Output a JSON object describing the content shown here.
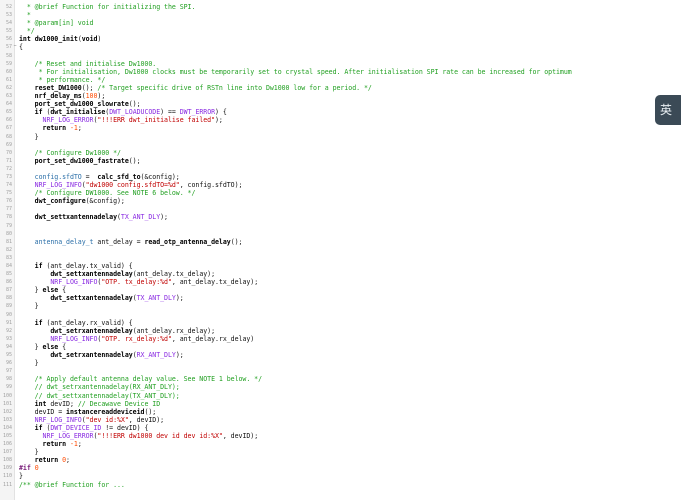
{
  "ime_indicator": "英",
  "lines": [
    {
      "n": "52",
      "fold": "",
      "parts": [
        {
          "c": "cm",
          "t": "  * @brief Function for initializing the SPI."
        }
      ]
    },
    {
      "n": "53",
      "fold": "",
      "parts": [
        {
          "c": "cm",
          "t": "  *"
        }
      ]
    },
    {
      "n": "54",
      "fold": "",
      "parts": [
        {
          "c": "cm",
          "t": "  * @param[in] void"
        }
      ]
    },
    {
      "n": "55",
      "fold": "",
      "parts": [
        {
          "c": "cm",
          "t": "  */"
        }
      ]
    },
    {
      "n": "56",
      "fold": "",
      "parts": [
        {
          "c": "kw",
          "t": "int"
        },
        {
          "c": "",
          "t": " "
        },
        {
          "c": "fn",
          "t": "dw1000_init"
        },
        {
          "c": "",
          "t": "("
        },
        {
          "c": "kw",
          "t": "void"
        },
        {
          "c": "",
          "t": ")"
        }
      ]
    },
    {
      "n": "57",
      "fold": "−",
      "parts": [
        {
          "c": "",
          "t": "{"
        }
      ]
    },
    {
      "n": "58",
      "fold": "",
      "parts": [
        {
          "c": "",
          "t": ""
        }
      ]
    },
    {
      "n": "59",
      "fold": "",
      "parts": [
        {
          "c": "cm",
          "t": "    /* Reset and initialise Dw1000."
        }
      ]
    },
    {
      "n": "60",
      "fold": "",
      "parts": [
        {
          "c": "cm",
          "t": "     * For initialisation, Dw1000 clocks must be temporarily set to crystal speed. After initialisation SPI rate can be increased for optimum"
        }
      ]
    },
    {
      "n": "61",
      "fold": "",
      "parts": [
        {
          "c": "cm",
          "t": "     * performance. */"
        }
      ]
    },
    {
      "n": "62",
      "fold": "",
      "parts": [
        {
          "c": "fn",
          "t": "    reset_DW1000"
        },
        {
          "c": "",
          "t": "(); "
        },
        {
          "c": "cm",
          "t": "/* Target specific drive of RSTn line into Dw1000 low for a period. */"
        }
      ]
    },
    {
      "n": "63",
      "fold": "",
      "parts": [
        {
          "c": "fn",
          "t": "    nrf_delay_ms"
        },
        {
          "c": "",
          "t": "("
        },
        {
          "c": "num",
          "t": "100"
        },
        {
          "c": "",
          "t": ");"
        }
      ]
    },
    {
      "n": "64",
      "fold": "",
      "parts": [
        {
          "c": "fn",
          "t": "    port_set_dw1000_slowrate"
        },
        {
          "c": "",
          "t": "();"
        }
      ]
    },
    {
      "n": "65",
      "fold": "",
      "parts": [
        {
          "c": "kw",
          "t": "    if"
        },
        {
          "c": "",
          "t": " ("
        },
        {
          "c": "fn",
          "t": "dwt_initialise"
        },
        {
          "c": "",
          "t": "("
        },
        {
          "c": "mac",
          "t": "DWT_LOADUCODE"
        },
        {
          "c": "",
          "t": ") == "
        },
        {
          "c": "mac",
          "t": "DWT_ERROR"
        },
        {
          "c": "",
          "t": ") {"
        }
      ]
    },
    {
      "n": "66",
      "fold": "",
      "parts": [
        {
          "c": "mac",
          "t": "      NRF_LOG_ERROR"
        },
        {
          "c": "",
          "t": "("
        },
        {
          "c": "str",
          "t": "\"!!!ERR dwt_initialise failed\""
        },
        {
          "c": "",
          "t": ");"
        }
      ]
    },
    {
      "n": "67",
      "fold": "",
      "parts": [
        {
          "c": "kw",
          "t": "      return"
        },
        {
          "c": "",
          "t": " "
        },
        {
          "c": "num",
          "t": "-1"
        },
        {
          "c": "",
          "t": ";"
        }
      ]
    },
    {
      "n": "68",
      "fold": "",
      "parts": [
        {
          "c": "",
          "t": "    }"
        }
      ]
    },
    {
      "n": "69",
      "fold": "",
      "parts": [
        {
          "c": "",
          "t": ""
        }
      ]
    },
    {
      "n": "70",
      "fold": "",
      "parts": [
        {
          "c": "cm",
          "t": "    /* Configure Dw1000 */"
        }
      ]
    },
    {
      "n": "71",
      "fold": "",
      "parts": [
        {
          "c": "fn",
          "t": "    port_set_dw1000_fastrate"
        },
        {
          "c": "",
          "t": "();"
        }
      ]
    },
    {
      "n": "72",
      "fold": "",
      "parts": [
        {
          "c": "",
          "t": ""
        }
      ]
    },
    {
      "n": "73",
      "fold": "",
      "parts": [
        {
          "c": "typ",
          "t": "    config.sfdTO"
        },
        {
          "c": "",
          "t": " =  "
        },
        {
          "c": "fn",
          "t": "calc_sfd_to"
        },
        {
          "c": "",
          "t": "(&config);"
        }
      ]
    },
    {
      "n": "74",
      "fold": "",
      "parts": [
        {
          "c": "mac",
          "t": "    NRF_LOG_INFO"
        },
        {
          "c": "",
          "t": "("
        },
        {
          "c": "str",
          "t": "\"dw1000 config.sfdTO=%d\""
        },
        {
          "c": "",
          "t": ", config.sfdTO);"
        }
      ]
    },
    {
      "n": "75",
      "fold": "",
      "parts": [
        {
          "c": "cm",
          "t": "    /* Configure DW1000. See NOTE 6 below. */"
        }
      ]
    },
    {
      "n": "76",
      "fold": "",
      "parts": [
        {
          "c": "fn",
          "t": "    dwt_configure"
        },
        {
          "c": "",
          "t": "(&config);"
        }
      ]
    },
    {
      "n": "77",
      "fold": "",
      "parts": [
        {
          "c": "",
          "t": ""
        }
      ]
    },
    {
      "n": "78",
      "fold": "",
      "parts": [
        {
          "c": "fn",
          "t": "    dwt_settxantennadelay"
        },
        {
          "c": "",
          "t": "("
        },
        {
          "c": "mac",
          "t": "TX_ANT_DLY"
        },
        {
          "c": "",
          "t": ");"
        }
      ]
    },
    {
      "n": "79",
      "fold": "",
      "parts": [
        {
          "c": "",
          "t": ""
        }
      ]
    },
    {
      "n": "80",
      "fold": "",
      "parts": [
        {
          "c": "",
          "t": ""
        }
      ]
    },
    {
      "n": "81",
      "fold": "",
      "parts": [
        {
          "c": "typ",
          "t": "    antenna_delay_t"
        },
        {
          "c": "",
          "t": " ant_delay = "
        },
        {
          "c": "fn",
          "t": "read_otp_antenna_delay"
        },
        {
          "c": "",
          "t": "();"
        }
      ]
    },
    {
      "n": "82",
      "fold": "",
      "parts": [
        {
          "c": "",
          "t": ""
        }
      ]
    },
    {
      "n": "83",
      "fold": "",
      "parts": [
        {
          "c": "",
          "t": ""
        }
      ]
    },
    {
      "n": "84",
      "fold": "",
      "parts": [
        {
          "c": "kw",
          "t": "    if"
        },
        {
          "c": "",
          "t": " (ant_delay.tx_valid) {"
        }
      ]
    },
    {
      "n": "85",
      "fold": "",
      "parts": [
        {
          "c": "fn",
          "t": "        dwt_settxantennadelay"
        },
        {
          "c": "",
          "t": "(ant_delay.tx_delay);"
        }
      ]
    },
    {
      "n": "86",
      "fold": "",
      "parts": [
        {
          "c": "mac",
          "t": "        NRF_LOG_INFO"
        },
        {
          "c": "",
          "t": "("
        },
        {
          "c": "str",
          "t": "\"OTP. tx_delay:%d\""
        },
        {
          "c": "",
          "t": ", ant_delay.tx_delay);"
        }
      ]
    },
    {
      "n": "87",
      "fold": "",
      "parts": [
        {
          "c": "",
          "t": "    } "
        },
        {
          "c": "kw",
          "t": "else"
        },
        {
          "c": "",
          "t": " {"
        }
      ]
    },
    {
      "n": "88",
      "fold": "",
      "parts": [
        {
          "c": "fn",
          "t": "        dwt_settxantennadelay"
        },
        {
          "c": "",
          "t": "("
        },
        {
          "c": "mac",
          "t": "TX_ANT_DLY"
        },
        {
          "c": "",
          "t": ");"
        }
      ]
    },
    {
      "n": "89",
      "fold": "",
      "parts": [
        {
          "c": "",
          "t": "    }"
        }
      ]
    },
    {
      "n": "90",
      "fold": "",
      "parts": [
        {
          "c": "",
          "t": ""
        }
      ]
    },
    {
      "n": "91",
      "fold": "",
      "parts": [
        {
          "c": "kw",
          "t": "    if"
        },
        {
          "c": "",
          "t": " (ant_delay.rx_valid) {"
        }
      ]
    },
    {
      "n": "92",
      "fold": "",
      "parts": [
        {
          "c": "fn",
          "t": "        dwt_setrxantennadelay"
        },
        {
          "c": "",
          "t": "(ant_delay.rx_delay);"
        }
      ]
    },
    {
      "n": "93",
      "fold": "",
      "parts": [
        {
          "c": "mac",
          "t": "        NRF_LOG_INFO"
        },
        {
          "c": "",
          "t": "("
        },
        {
          "c": "str",
          "t": "\"OTP. rx_delay:%d\""
        },
        {
          "c": "",
          "t": ", ant_delay.rx_delay)"
        }
      ]
    },
    {
      "n": "94",
      "fold": "",
      "parts": [
        {
          "c": "",
          "t": "    } "
        },
        {
          "c": "kw",
          "t": "else"
        },
        {
          "c": "",
          "t": " {"
        }
      ]
    },
    {
      "n": "95",
      "fold": "",
      "parts": [
        {
          "c": "fn",
          "t": "        dwt_setrxantennadelay"
        },
        {
          "c": "",
          "t": "("
        },
        {
          "c": "mac",
          "t": "RX_ANT_DLY"
        },
        {
          "c": "",
          "t": ");"
        }
      ]
    },
    {
      "n": "96",
      "fold": "",
      "parts": [
        {
          "c": "",
          "t": "    }"
        }
      ]
    },
    {
      "n": "97",
      "fold": "",
      "parts": [
        {
          "c": "",
          "t": ""
        }
      ]
    },
    {
      "n": "98",
      "fold": "",
      "parts": [
        {
          "c": "cm",
          "t": "    /* Apply default antenna delay value. See NOTE 1 below. */"
        }
      ]
    },
    {
      "n": "99",
      "fold": "",
      "parts": [
        {
          "c": "cm",
          "t": "    // dwt_setrxantennadelay(RX_ANT_DLY);"
        }
      ]
    },
    {
      "n": "100",
      "fold": "",
      "parts": [
        {
          "c": "cm",
          "t": "    // dwt_settxantennadelay(TX_ANT_DLY);"
        }
      ]
    },
    {
      "n": "101",
      "fold": "",
      "parts": [
        {
          "c": "kw",
          "t": "    int"
        },
        {
          "c": "",
          "t": " devID; "
        },
        {
          "c": "cm",
          "t": "// Decawave Device ID"
        }
      ]
    },
    {
      "n": "102",
      "fold": "",
      "parts": [
        {
          "c": "",
          "t": "    devID = "
        },
        {
          "c": "fn",
          "t": "instancereaddeviceid"
        },
        {
          "c": "",
          "t": "();"
        }
      ]
    },
    {
      "n": "103",
      "fold": "",
      "parts": [
        {
          "c": "mac",
          "t": "    NRF_LOG_INFO"
        },
        {
          "c": "",
          "t": "("
        },
        {
          "c": "str",
          "t": "\"dev id:%X\""
        },
        {
          "c": "",
          "t": ", devID);"
        }
      ]
    },
    {
      "n": "104",
      "fold": "",
      "parts": [
        {
          "c": "kw",
          "t": "    if"
        },
        {
          "c": "",
          "t": " ("
        },
        {
          "c": "mac",
          "t": "DWT_DEVICE_ID"
        },
        {
          "c": "",
          "t": " != devID) {"
        }
      ]
    },
    {
      "n": "105",
      "fold": "",
      "parts": [
        {
          "c": "mac",
          "t": "      NRF_LOG_ERROR"
        },
        {
          "c": "",
          "t": "("
        },
        {
          "c": "str",
          "t": "\"!!!ERR dw1000 dev id dev id:%X\""
        },
        {
          "c": "",
          "t": ", devID);"
        }
      ]
    },
    {
      "n": "106",
      "fold": "",
      "parts": [
        {
          "c": "kw",
          "t": "      return"
        },
        {
          "c": "",
          "t": " "
        },
        {
          "c": "num",
          "t": "-1"
        },
        {
          "c": "",
          "t": ";"
        }
      ]
    },
    {
      "n": "107",
      "fold": "",
      "parts": [
        {
          "c": "",
          "t": "    }"
        }
      ]
    },
    {
      "n": "108",
      "fold": "",
      "parts": [
        {
          "c": "kw",
          "t": "    return"
        },
        {
          "c": "",
          "t": " "
        },
        {
          "c": "num",
          "t": "0"
        },
        {
          "c": "",
          "t": ";"
        }
      ]
    },
    {
      "n": "109",
      "fold": "",
      "parts": [
        {
          "c": "pp",
          "t": "#if"
        },
        {
          "c": "",
          "t": " "
        },
        {
          "c": "num",
          "t": "0"
        }
      ]
    },
    {
      "n": "110",
      "fold": "",
      "parts": [
        {
          "c": "",
          "t": "}"
        }
      ]
    },
    {
      "n": "111",
      "fold": "",
      "parts": [
        {
          "c": "cm",
          "t": "/** @brief Function for ..."
        }
      ]
    }
  ]
}
